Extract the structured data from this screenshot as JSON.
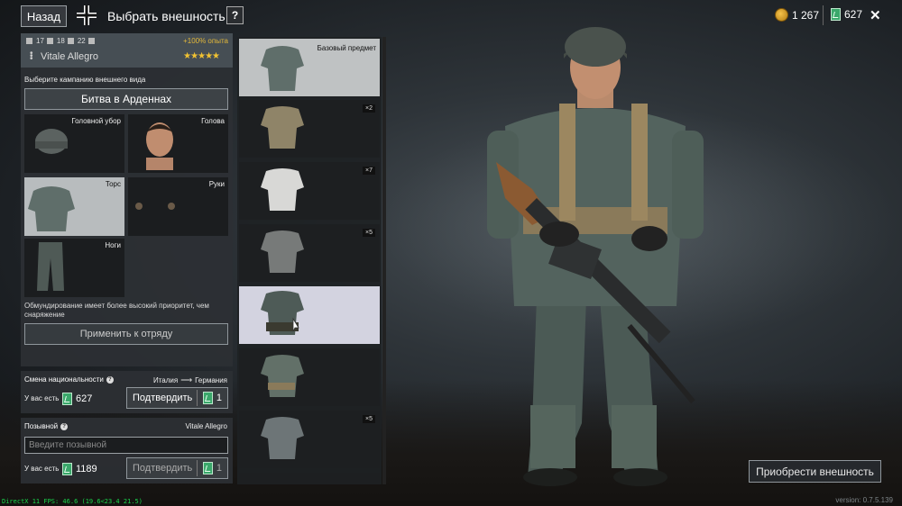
{
  "header": {
    "back_label": "Назад",
    "title": "Выбрать внешность",
    "help_label": "?",
    "gold_amount": "1 267",
    "tickets_amount": "627",
    "close_label": "✕"
  },
  "soldier": {
    "stats": [
      "17",
      "18",
      "22"
    ],
    "xp_bonus": "+100% опыта",
    "name": "Vitale Allegro",
    "rating_stars": "★★★★★"
  },
  "appearance": {
    "campaign_prompt": "Выберите кампанию внешнего вида",
    "campaign_value": "Битва в Арденнах",
    "slots": [
      {
        "label": "Головной убор"
      },
      {
        "label": "Голова"
      },
      {
        "label": "Торс"
      },
      {
        "label": "Руки"
      },
      {
        "label": "Ноги"
      }
    ],
    "priority_note": "Обмундирование имеет более высокий приоритет, чем снаряжение",
    "apply_label": "Применить к отряду"
  },
  "nationality": {
    "title": "Смена национальности",
    "from": "Италия",
    "to": "Германия",
    "have_label": "У вас есть",
    "have_amount": "627",
    "confirm_label": "Подтвердить",
    "cost": "1"
  },
  "callsign": {
    "title": "Позывной",
    "current_name": "Vitale Allegro",
    "placeholder": "Введите позывной",
    "have_label": "У вас есть",
    "have_amount": "1189",
    "confirm_label": "Подтвердить",
    "cost": "1"
  },
  "items": [
    {
      "badge": "Базовый предмет"
    },
    {
      "badge": "×2"
    },
    {
      "badge": "×7"
    },
    {
      "badge": "×5"
    },
    {
      "badge": ""
    },
    {
      "badge": ""
    },
    {
      "badge": "×5"
    }
  ],
  "footer": {
    "buy_label": "Приобрести внешность",
    "version": "version: 0.7.5.139",
    "fps": "DirectX 11 FPS: 46.6 (19.6<23.4 21.5)"
  },
  "colors": {
    "gold": "#f1c232",
    "ticket": "#3aa86b",
    "xp": "#e3b83a",
    "fps_text": "#19d34b"
  }
}
